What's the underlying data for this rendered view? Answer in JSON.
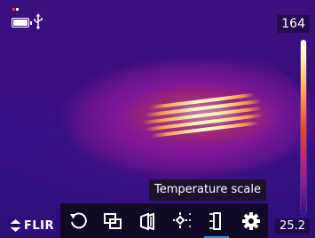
{
  "status_bar": {
    "battery_icon": "battery-full-icon",
    "usb_icon": "usb-icon"
  },
  "temperature_scale": {
    "max": "164",
    "min": "25.2",
    "palette": "iron"
  },
  "tooltip": {
    "text": "Temperature scale"
  },
  "logo": {
    "text": "FLIR"
  },
  "toolbar": {
    "tools": [
      {
        "icon": "rotate-icon",
        "selected": false
      },
      {
        "icon": "picture-in-picture-icon",
        "selected": false
      },
      {
        "icon": "color-palette-icon",
        "selected": false
      },
      {
        "icon": "measurement-spot-icon",
        "selected": false
      },
      {
        "icon": "temperature-scale-icon",
        "selected": true
      },
      {
        "icon": "settings-gear-icon",
        "selected": false
      }
    ]
  },
  "colors": {
    "accent": "#2b8fe8",
    "background_cold": "#3a0e7d",
    "hot": "#fff6d0"
  }
}
